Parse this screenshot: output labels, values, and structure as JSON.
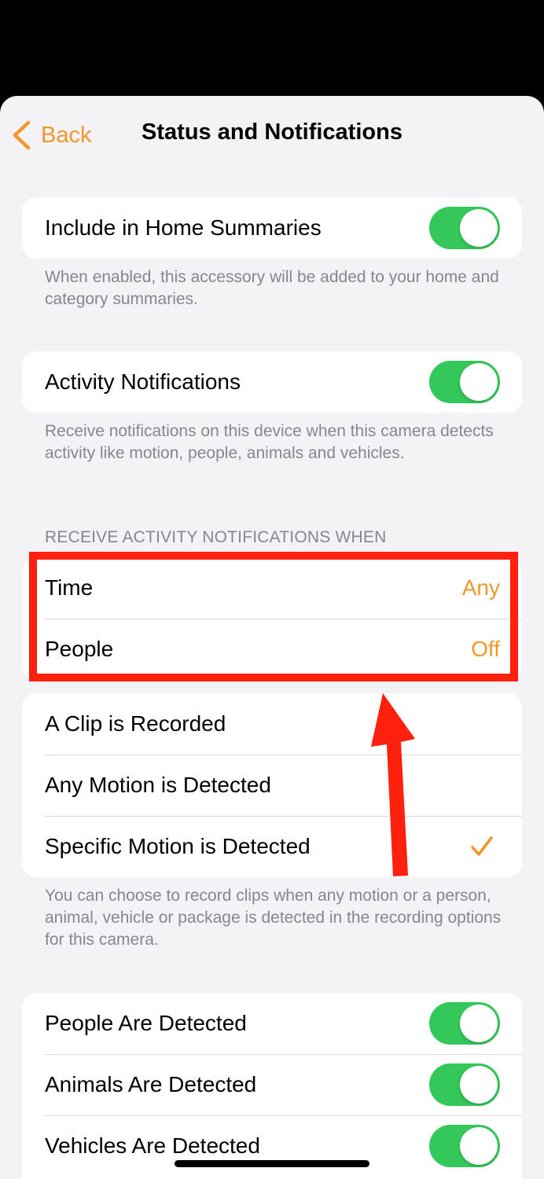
{
  "nav": {
    "back_label": "Back",
    "title": "Status and Notifications"
  },
  "summaries": {
    "label": "Include in Home Summaries",
    "enabled": true,
    "footnote": "When enabled, this accessory will be added to your home and category summaries."
  },
  "activity": {
    "label": "Activity Notifications",
    "enabled": true,
    "footnote": "Receive notifications on this device when this camera detects activity like motion, people, animals and vehicles."
  },
  "receive_when": {
    "header": "RECEIVE ACTIVITY NOTIFICATIONS WHEN",
    "items": [
      {
        "label": "Time",
        "value": "Any"
      },
      {
        "label": "People",
        "value": "Off"
      }
    ]
  },
  "motion": {
    "options": [
      {
        "label": "A Clip is Recorded",
        "selected": false
      },
      {
        "label": "Any Motion is Detected",
        "selected": false
      },
      {
        "label": "Specific Motion is Detected",
        "selected": true
      }
    ],
    "footnote": "You can choose to record clips when any motion or a person, animal, vehicle or package is detected in the recording options for this camera."
  },
  "detections": [
    {
      "label": "People Are Detected",
      "enabled": true
    },
    {
      "label": "Animals Are Detected",
      "enabled": true
    },
    {
      "label": "Vehicles Are Detected",
      "enabled": true
    }
  ],
  "colors": {
    "accent": "#f3962b",
    "toggle_on": "#34c759",
    "annotation": "#ff200e"
  }
}
